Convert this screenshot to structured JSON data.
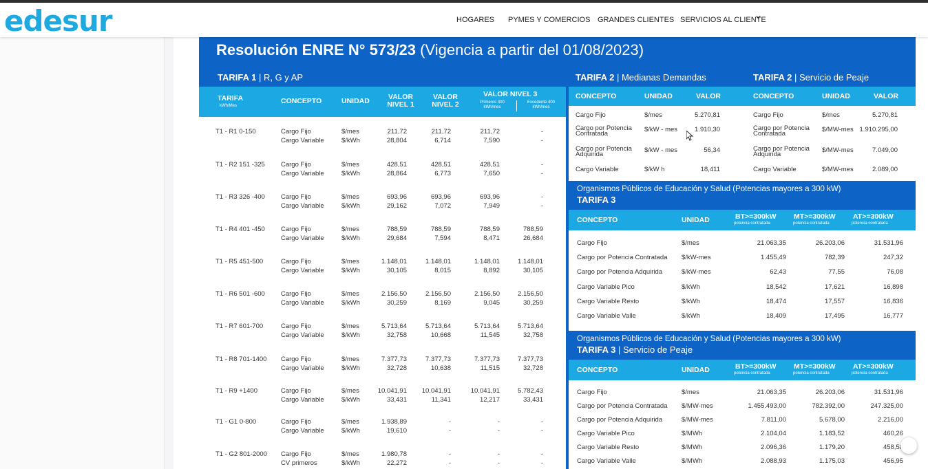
{
  "brand": {
    "logo_text": "edesur"
  },
  "nav": {
    "items": [
      "HOGARES",
      "PYMES Y COMERCIOS",
      "GRANDES CLIENTES",
      "SERVICIOS AL CLIENTE"
    ]
  },
  "doc": {
    "title_bold": "Resolución ENRE N° 573/23",
    "title_sub": "(Vigencia a partir del 01/08/2023)",
    "tarifa1": {
      "label": "TARIFA 1",
      "desc": "| R, G y AP"
    },
    "tarifa2": {
      "label": "TARIFA 2",
      "desc": "| Medianas Demandas"
    },
    "tarifa2peaje": {
      "label": "TARIFA 2",
      "desc": "| Servicio de Peaje"
    }
  },
  "t1": {
    "headers": {
      "tarifa": "TARIFA",
      "tarifa_unit": "kWh/Mes",
      "concepto": "CONCEPTO",
      "unidad": "UNIDAD",
      "n1": "VALOR NIVEL 1",
      "n2": "VALOR NIVEL 2",
      "n3": "VALOR NIVEL 3",
      "n3a": "Primeros 400 kWh/mes",
      "n3b": "Excedente 400 kWh/mes"
    },
    "rows": [
      {
        "tarifa": "T1 - R1 0-150",
        "c1": "Cargo Fijo",
        "c2": "Cargo Variable",
        "u1": "$/mes",
        "u2": "$/kWh",
        "n1a": "211,72",
        "n1b": "28,804",
        "n2a": "211,72",
        "n2b": "6,714",
        "n3aa": "211,72",
        "n3ab": "7,590",
        "n3ba": "-",
        "n3bb": "-"
      },
      {
        "tarifa": "T1 - R2 151 -325",
        "c1": "Cargo Fijo",
        "c2": "Cargo Variable",
        "u1": "$/mes",
        "u2": "$/kWh",
        "n1a": "428,51",
        "n1b": "28,864",
        "n2a": "428,51",
        "n2b": "6,773",
        "n3aa": "428,51",
        "n3ab": "7,650",
        "n3ba": "-",
        "n3bb": "-"
      },
      {
        "tarifa": "T1 - R3 326 -400",
        "c1": "Cargo Fijo",
        "c2": "Cargo Variable",
        "u1": "$/mes",
        "u2": "$/kWh",
        "n1a": "693,96",
        "n1b": "29,162",
        "n2a": "693,96",
        "n2b": "7,072",
        "n3aa": "693,96",
        "n3ab": "7,949",
        "n3ba": "-",
        "n3bb": "-"
      },
      {
        "tarifa": "T1 - R4 401 -450",
        "c1": "Cargo Fijo",
        "c2": "Cargo Variable",
        "u1": "$/mes",
        "u2": "$/kWh",
        "n1a": "788,59",
        "n1b": "29,684",
        "n2a": "788,59",
        "n2b": "7,594",
        "n3aa": "788,59",
        "n3ab": "8,471",
        "n3ba": "788,59",
        "n3bb": "26,684"
      },
      {
        "tarifa": "T1 - R5 451-500",
        "c1": "Cargo Fijo",
        "c2": "Cargo Variable",
        "u1": "$/mes",
        "u2": "$/kWh",
        "n1a": "1.148,01",
        "n1b": "30,105",
        "n2a": "1.148,01",
        "n2b": "8,015",
        "n3aa": "1.148,01",
        "n3ab": "8,892",
        "n3ba": "1.148,01",
        "n3bb": "30,105"
      },
      {
        "tarifa": "T1 - R6 501 -600",
        "c1": "Cargo Fijo",
        "c2": "Cargo Variable",
        "u1": "$/mes",
        "u2": "$/kWh",
        "n1a": "2.156,50",
        "n1b": "30,259",
        "n2a": "2.156,50",
        "n2b": "8,169",
        "n3aa": "2.156,50",
        "n3ab": "9,045",
        "n3ba": "2.156,50",
        "n3bb": "30,259"
      },
      {
        "tarifa": "T1 - R7 601-700",
        "c1": "Cargo Fijo",
        "c2": "Cargo Variable",
        "u1": "$/mes",
        "u2": "$/kWh",
        "n1a": "5.713,64",
        "n1b": "32,758",
        "n2a": "5.713,64",
        "n2b": "10,668",
        "n3aa": "5.713,64",
        "n3ab": "11,545",
        "n3ba": "5.713,64",
        "n3bb": "32,758"
      },
      {
        "tarifa": "T1 - R8 701-1400",
        "c1": "Cargo Fijo",
        "c2": "Cargo Variable",
        "u1": "$/mes",
        "u2": "$/kWh",
        "n1a": "7.377,73",
        "n1b": "32,728",
        "n2a": "7.377,73",
        "n2b": "10,638",
        "n3aa": "7.377,73",
        "n3ab": "11,515",
        "n3ba": "7.377,73",
        "n3bb": "32,728"
      },
      {
        "tarifa": "T1 - R9 +1400",
        "c1": "Cargo Fijo",
        "c2": "Cargo Variable",
        "u1": "$/mes",
        "u2": "$/kWh",
        "n1a": "10.041,91",
        "n1b": "33,431",
        "n2a": "10.041,91",
        "n2b": "11,341",
        "n3aa": "10.041,91",
        "n3ab": "12,217",
        "n3ba": "5.782,43",
        "n3bb": "33,431"
      },
      {
        "tarifa": "T1 - G1 0-800",
        "c1": "Cargo Fijo",
        "c2": "Cargo Variable",
        "u1": "$/mes",
        "u2": "$/kWh",
        "n1a": "1.938,89",
        "n1b": "19,610",
        "n2a": "-",
        "n2b": "-",
        "n3aa": "-",
        "n3ab": "-",
        "n3ba": "-",
        "n3bb": "-"
      },
      {
        "tarifa": "T1 - G2 801-2000",
        "c1": "Cargo Fijo",
        "c2": "CV primeros",
        "u1": "$/mes",
        "u2": "$/kWh",
        "n1a": "1.980,78",
        "n1b": "22,272",
        "n2a": "-",
        "n2b": "-",
        "n3aa": "-",
        "n3ab": "-",
        "n3ba": "-",
        "n3bb": "-"
      }
    ]
  },
  "t2": {
    "headers": {
      "concepto": "CONCEPTO",
      "unidad": "UNIDAD",
      "valor": "VALOR"
    },
    "rows": [
      {
        "c1": "Cargo Fijo",
        "c2": "",
        "u": "$/mes",
        "v": "5.270,81"
      },
      {
        "c1": "Cargo por Potencia",
        "c2": "Contratada",
        "u": "$/kW - mes",
        "v": "1.910,30"
      },
      {
        "c1": "Cargo por Potencia",
        "c2": "Adquirida",
        "u": "$/kW - mes",
        "v": "56,34"
      },
      {
        "c1": "Cargo Variable",
        "c2": "",
        "u": "$/kW h",
        "v": "18,411"
      }
    ]
  },
  "t2p": {
    "headers": {
      "concepto": "CONCEPTO",
      "unidad": "UNIDAD",
      "valor": "VALOR"
    },
    "rows": [
      {
        "c1": "Cargo Fijo",
        "c2": "",
        "u": "$/mes",
        "v": "5.270,81"
      },
      {
        "c1": "Cargo por Potencia",
        "c2": "Contratada",
        "u": "$/MW-mes",
        "v": "1.910.295,00"
      },
      {
        "c1": "Cargo por Potencia",
        "c2": "Adquirida",
        "u": "$/MW-mes",
        "v": "7.049,00"
      },
      {
        "c1": "Cargo Variable",
        "c2": "",
        "u": "$/MW-mes",
        "v": "2.089,00"
      }
    ]
  },
  "t3": {
    "band_line1": "Organismos Públicos de Educación y Salud (Potencias mayores a 300 kW)",
    "band_label": "TARIFA 3",
    "band_desc": "",
    "headers": {
      "concepto": "CONCEPTO",
      "unidad": "UNIDAD",
      "bt": "BT>=300kW",
      "mt": "MT>=300kW",
      "at": "AT>=300kW",
      "sub": "potencia contratada"
    },
    "rows": [
      {
        "c": "Cargo Fijo",
        "u": "$/mes",
        "bt": "21.063,35",
        "mt": "26.203,06",
        "at": "31.531,96"
      },
      {
        "c": "Cargo por Potencia Contratada",
        "u": "$/kW-mes",
        "bt": "1.455,49",
        "mt": "782,39",
        "at": "247,32"
      },
      {
        "c": "Cargo por Potencia Adquirida",
        "u": "$/kW-mes",
        "bt": "62,43",
        "mt": "77,55",
        "at": "76,08"
      },
      {
        "c": "Cargo Variable Pico",
        "u": "$/kWh",
        "bt": "18,542",
        "mt": "17,621",
        "at": "16,898"
      },
      {
        "c": "Cargo Variable Resto",
        "u": "$/kWh",
        "bt": "18,474",
        "mt": "17,557",
        "at": "16,836"
      },
      {
        "c": "Cargo Variable Valle",
        "u": "$/kWh",
        "bt": "18,409",
        "mt": "17,495",
        "at": "16,777"
      }
    ]
  },
  "t3p": {
    "band_line1": "Organismos Públicos de Educación y Salud (Potencias mayores a 300 kW)",
    "band_label": "TARIFA 3",
    "band_desc": "| Servicio de Peaje",
    "headers": {
      "concepto": "CONCEPTO",
      "unidad": "UNIDAD",
      "bt": "BT>=300kW",
      "mt": "MT>=300kW",
      "at": "AT>=300kW",
      "sub": "potencia contratada"
    },
    "rows": [
      {
        "c": "Cargo Fijo",
        "u": "$/mes",
        "bt": "21.063,35",
        "mt": "26.203,06",
        "at": "31.531,96"
      },
      {
        "c": "Cargo por Potencia Contratada",
        "u": "$/MW-mes",
        "bt": "1.455.493,00",
        "mt": "782.392,00",
        "at": "247.325,00"
      },
      {
        "c": "Cargo por Potencia Adquirida",
        "u": "$/MW-mes",
        "bt": "7.811,00",
        "mt": "5.678,00",
        "at": "2.216,00"
      },
      {
        "c": "Cargo Variable Pico",
        "u": "$/MWh",
        "bt": "2.104,04",
        "mt": "1.183,52",
        "at": "460,26"
      },
      {
        "c": "Cargo Variable Resto",
        "u": "$/MWh",
        "bt": "2.096,36",
        "mt": "1.179,20",
        "at": "458,58"
      },
      {
        "c": "Cargo Variable Valle",
        "u": "$/MWh",
        "bt": "2.088,93",
        "mt": "1.175,03",
        "at": "456,95"
      }
    ]
  }
}
